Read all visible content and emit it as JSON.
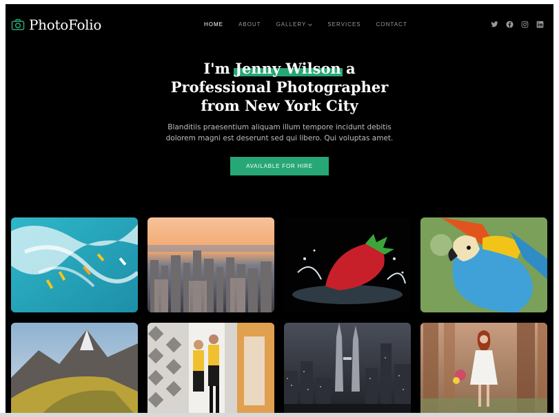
{
  "brand": {
    "name": "PhotoFolio",
    "accent": "#27a776",
    "logo_icon": "camera-icon"
  },
  "nav": {
    "items": [
      {
        "label": "HOME",
        "active": true
      },
      {
        "label": "ABOUT",
        "active": false
      },
      {
        "label": "GALLERY",
        "active": false,
        "has_dropdown": true
      },
      {
        "label": "SERVICES",
        "active": false
      },
      {
        "label": "CONTACT",
        "active": false
      }
    ]
  },
  "social": {
    "icons": [
      "twitter-icon",
      "facebook-icon",
      "instagram-icon",
      "linkedin-icon"
    ]
  },
  "hero": {
    "title_pre": "I'm ",
    "title_highlight": "Jenny Wilson",
    "title_post": " a",
    "title_line2": "Professional Photographer",
    "title_line3": "from New York City",
    "subtitle_line1": "Blanditiis praesentium aliquam illum tempore incidunt debitis",
    "subtitle_line2": "dolorem magni est deserunt sed qui libero. Qui voluptas amet.",
    "cta_label": "AVAILABLE FOR HIRE"
  },
  "gallery": {
    "tiles": [
      "surfers-photo",
      "city-skyline-photo",
      "strawberry-splash-photo",
      "macaw-parrot-photo",
      "mountain-peaks-photo",
      "mirror-fashion-photo",
      "city-night-towers-photo",
      "forest-woman-photo"
    ]
  }
}
